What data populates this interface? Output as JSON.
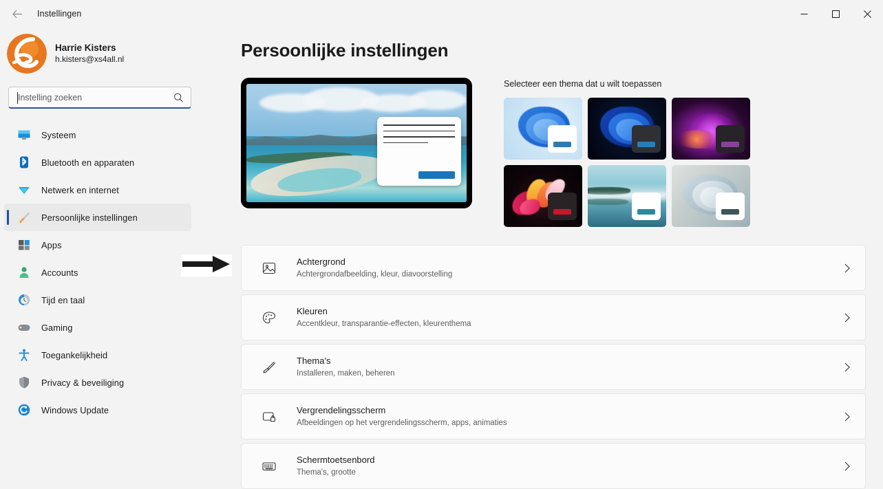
{
  "titlebar": {
    "back_icon": "back-arrow-icon",
    "title": "Instellingen",
    "minimize_label": "–",
    "maximize_label": "□",
    "close_label": "✕"
  },
  "account": {
    "avatar_icon": "user-avatar-logo",
    "name": "Harrie Kisters",
    "email": "h.kisters@xs4all.nl"
  },
  "search": {
    "placeholder": "Instelling zoeken",
    "value": "",
    "icon": "search-icon"
  },
  "sidebar": {
    "items": [
      {
        "label": "Systeem",
        "icon": "monitor-icon",
        "selected": false
      },
      {
        "label": "Bluetooth en apparaten",
        "icon": "bluetooth-icon",
        "selected": false
      },
      {
        "label": "Netwerk en internet",
        "icon": "wifi-icon",
        "selected": false
      },
      {
        "label": "Persoonlijke instellingen",
        "icon": "paintbrush-icon",
        "selected": true
      },
      {
        "label": "Apps",
        "icon": "apps-grid-icon",
        "selected": false
      },
      {
        "label": "Accounts",
        "icon": "person-icon",
        "selected": false
      },
      {
        "label": "Tijd en taal",
        "icon": "clock-globe-icon",
        "selected": false
      },
      {
        "label": "Gaming",
        "icon": "gamepad-icon",
        "selected": false
      },
      {
        "label": "Toegankelijkheid",
        "icon": "accessibility-icon",
        "selected": false
      },
      {
        "label": "Privacy & beveiliging",
        "icon": "shield-icon",
        "selected": false
      },
      {
        "label": "Windows Update",
        "icon": "update-refresh-icon",
        "selected": false
      }
    ]
  },
  "main": {
    "page_title": "Persoonlijke instellingen",
    "preview": {
      "name": "theme-preview-monitor",
      "dialog_button_color": "#1b75bb"
    },
    "themes": {
      "label": "Selecteer een thema dat u wilt toepassen",
      "tiles": [
        {
          "name": "windows-light-bloom",
          "wall": "wall-bloom-light",
          "win_bg": "#ffffff",
          "bar_color": "#2b7cb5",
          "selected": true
        },
        {
          "name": "windows-dark-bloom",
          "wall": "wall-bloom-dark",
          "win_bg": "#2e3034",
          "bar_color": "#2b7cb5",
          "selected": false
        },
        {
          "name": "glow-theme",
          "wall": "wall-glow",
          "win_bg": "#262329",
          "bar_color": "#8c3f9e",
          "selected": false
        },
        {
          "name": "flow-theme",
          "wall": "wall-flow",
          "win_bg": "#2a2326",
          "bar_color": "#c7182b",
          "selected": false
        },
        {
          "name": "captured-motion-theme",
          "wall": "wall-captured",
          "win_bg": "#ffffff",
          "bar_color": "#2b8a9e",
          "selected": false
        },
        {
          "name": "sunrise-theme",
          "wall": "wall-sunrise",
          "win_bg": "#ffffff",
          "bar_color": "#3f545c",
          "selected": false
        }
      ]
    },
    "settings_rows": [
      {
        "title": "Achtergrond",
        "subtitle": "Achtergrondafbeelding, kleur, diavoorstelling",
        "icon": "picture-icon",
        "chevron": "chevron-right-icon"
      },
      {
        "title": "Kleuren",
        "subtitle": "Accentkleur, transparantie-effecten, kleurenthema",
        "icon": "color-palette-icon",
        "chevron": "chevron-right-icon"
      },
      {
        "title": "Thema's",
        "subtitle": "Installeren, maken, beheren",
        "icon": "paintbrush-icon",
        "chevron": "chevron-right-icon"
      },
      {
        "title": "Vergrendelingsscherm",
        "subtitle": "Afbeeldingen op het vergrendelingsscherm, apps, animaties",
        "icon": "lock-screen-icon",
        "chevron": "chevron-right-icon"
      },
      {
        "title": "Schermtoetsenbord",
        "subtitle": "Thema's, grootte",
        "icon": "keyboard-icon",
        "chevron": "chevron-right-icon"
      }
    ]
  },
  "annotation": {
    "arrow_icon": "pointer-arrow-right-icon"
  },
  "colors": {
    "accent": "#1e4fa3",
    "window_bg": "#f3f3f3",
    "card_bg": "#fbfbfb",
    "text": "#1b1b1b",
    "subtext": "#5d5d5d"
  }
}
